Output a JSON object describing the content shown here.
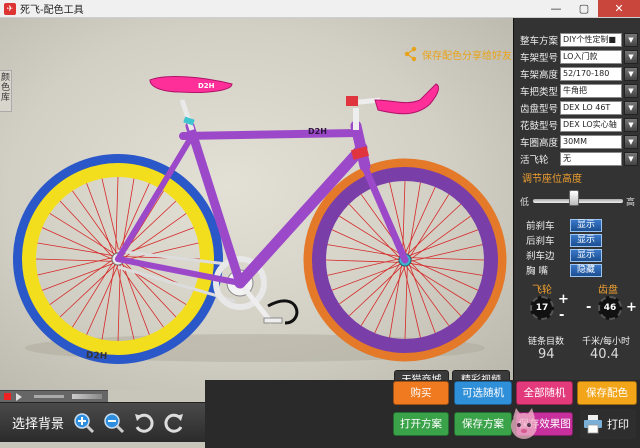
{
  "window": {
    "title": "死飞-配色工具",
    "minimize": "—",
    "maximize": "▢",
    "close": "✕"
  },
  "side_tab": "颜色库",
  "share": {
    "label": "保存配色分享给好友"
  },
  "bike": {
    "brand_text": "D2H"
  },
  "stage_buttons": {
    "shop": "天猫商城",
    "video": "精彩视频"
  },
  "panel": {
    "rows": [
      {
        "label": "整车方案",
        "value": "DIY个性定制■"
      },
      {
        "label": "车架型号",
        "value": "LO入门款"
      },
      {
        "label": "车架高度",
        "value": "52/170-180"
      },
      {
        "label": "车把类型",
        "value": "牛角把"
      },
      {
        "label": "齿盘型号",
        "value": "DEX LO 46T"
      },
      {
        "label": "花鼓型号",
        "value": "DEX LO实心轴"
      },
      {
        "label": "车圈高度",
        "value": "30MM"
      },
      {
        "label": "活飞轮",
        "value": "无"
      }
    ],
    "seat_heading": "调节座位高度",
    "slider": {
      "low": "低",
      "high": "高",
      "level": 0.45
    },
    "toggles": [
      {
        "label": "前刹车",
        "value": "显示"
      },
      {
        "label": "后刹车",
        "value": "显示"
      },
      {
        "label": "刹车边",
        "value": "显示"
      },
      {
        "label": "胸 嘴",
        "value": "隐藏"
      }
    ],
    "gears": {
      "flywheel_label": "飞轮",
      "chainring_label": "齿盘",
      "flywheel_value": "17",
      "chainring_value": "46",
      "minus": "-",
      "plus": "+"
    },
    "stats": {
      "chain_label": "链条目数",
      "chain_value": "94",
      "speed_label": "千米/每小时",
      "speed_value": "40.4"
    }
  },
  "toolbar": {
    "select_bg": "选择背景"
  },
  "actions": {
    "buy": "购买",
    "random_optional": "可选随机",
    "random_all": "全部随机",
    "save_color": "保存配色",
    "open_plan": "打开方案",
    "save_plan": "保存方案",
    "save_image": "保存效果图",
    "print": "打印"
  },
  "colors": {
    "frame": "#9b49c9",
    "front_rim": "#7a3ea8",
    "front_tire": "#e4792a",
    "rear_rim": "#f3de1d",
    "rear_tire": "#2a58c8",
    "spokes": "#d62828",
    "saddle": "#ff2f9a",
    "bar_tape": "#ff2f9a",
    "chain": "#dcdcdc",
    "accent": "#f0a030",
    "buy": "#f07a20",
    "random_optional": "#2f8fd8",
    "random_all": "#e33a7c",
    "save_color": "#f3a51a",
    "open_plan": "#3aa34a",
    "save_plan": "#3aa34a",
    "save_image": "#c7309c"
  }
}
